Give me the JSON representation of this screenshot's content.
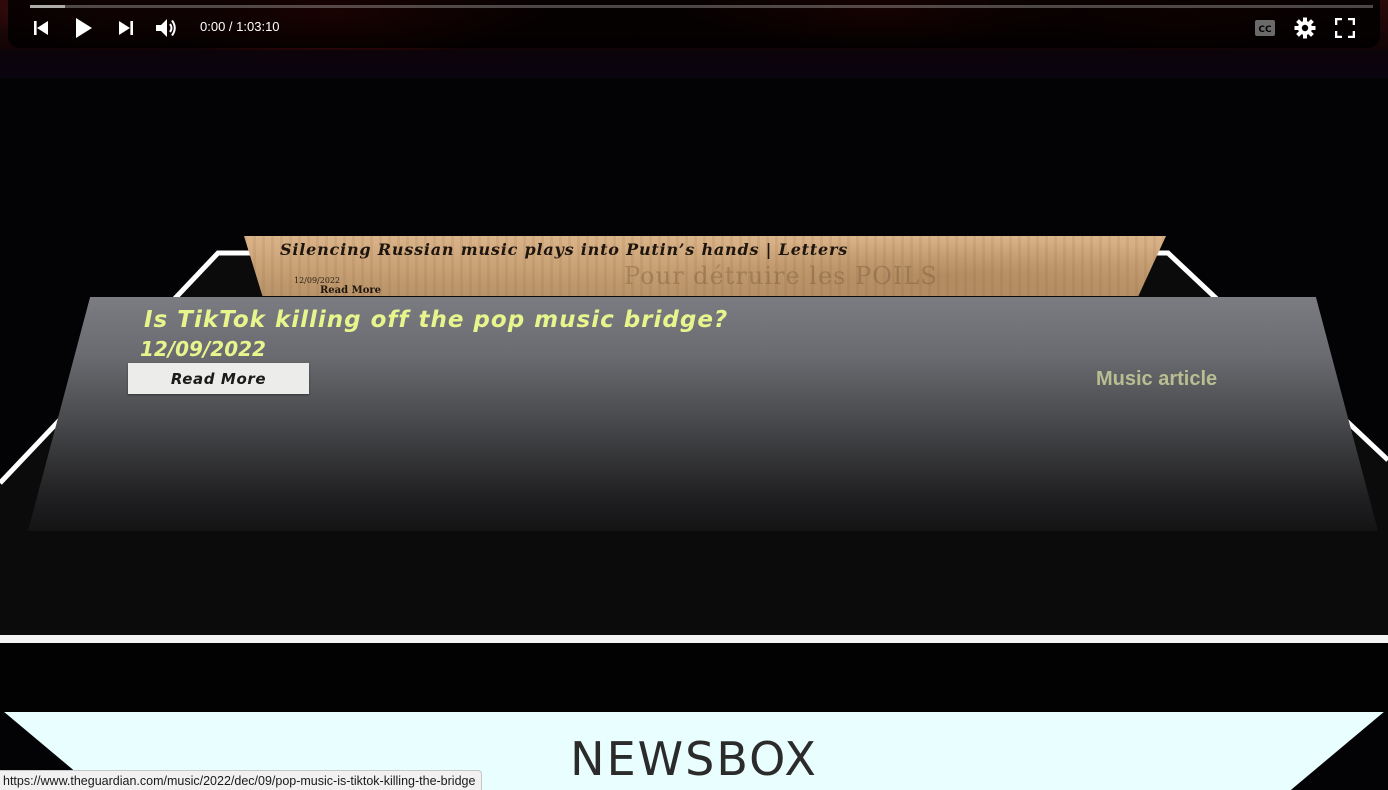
{
  "player": {
    "time_current": "0:00",
    "time_separator": " / ",
    "time_total": "1:03:10",
    "played_fraction": 0.0,
    "buffered_fraction": 0.026,
    "icons": {
      "previous": "skip-previous-icon",
      "play": "play-icon",
      "next": "skip-next-icon",
      "volume": "volume-icon",
      "captions": "closed-captions-icon",
      "settings": "gear-icon",
      "fullscreen": "fullscreen-icon"
    },
    "captions_badge": "CC"
  },
  "articles": [
    {
      "title": "Silencing Russian music plays into Putin’s hands | Letters",
      "date": "12/09/2022",
      "read_more": "Read More",
      "background_text": "Pour détruire les POILS"
    },
    {
      "title": "Is TikTok killing off the pop music bridge?",
      "date": "12/09/2022",
      "read_more": "Read More",
      "category": "Music article"
    }
  ],
  "newsbox": {
    "title": "NEWSBOX"
  },
  "status_bar": {
    "url": "https://www.theguardian.com/music/2022/dec/09/pop-music-is-tiktok-killing-the-bridge"
  },
  "colors": {
    "headline_accent": "#e8f58c",
    "category_text": "#b9bd92",
    "button_bg": "#ececea",
    "newsbox_bg": "#e9fefe",
    "page_bg": "#030204"
  }
}
